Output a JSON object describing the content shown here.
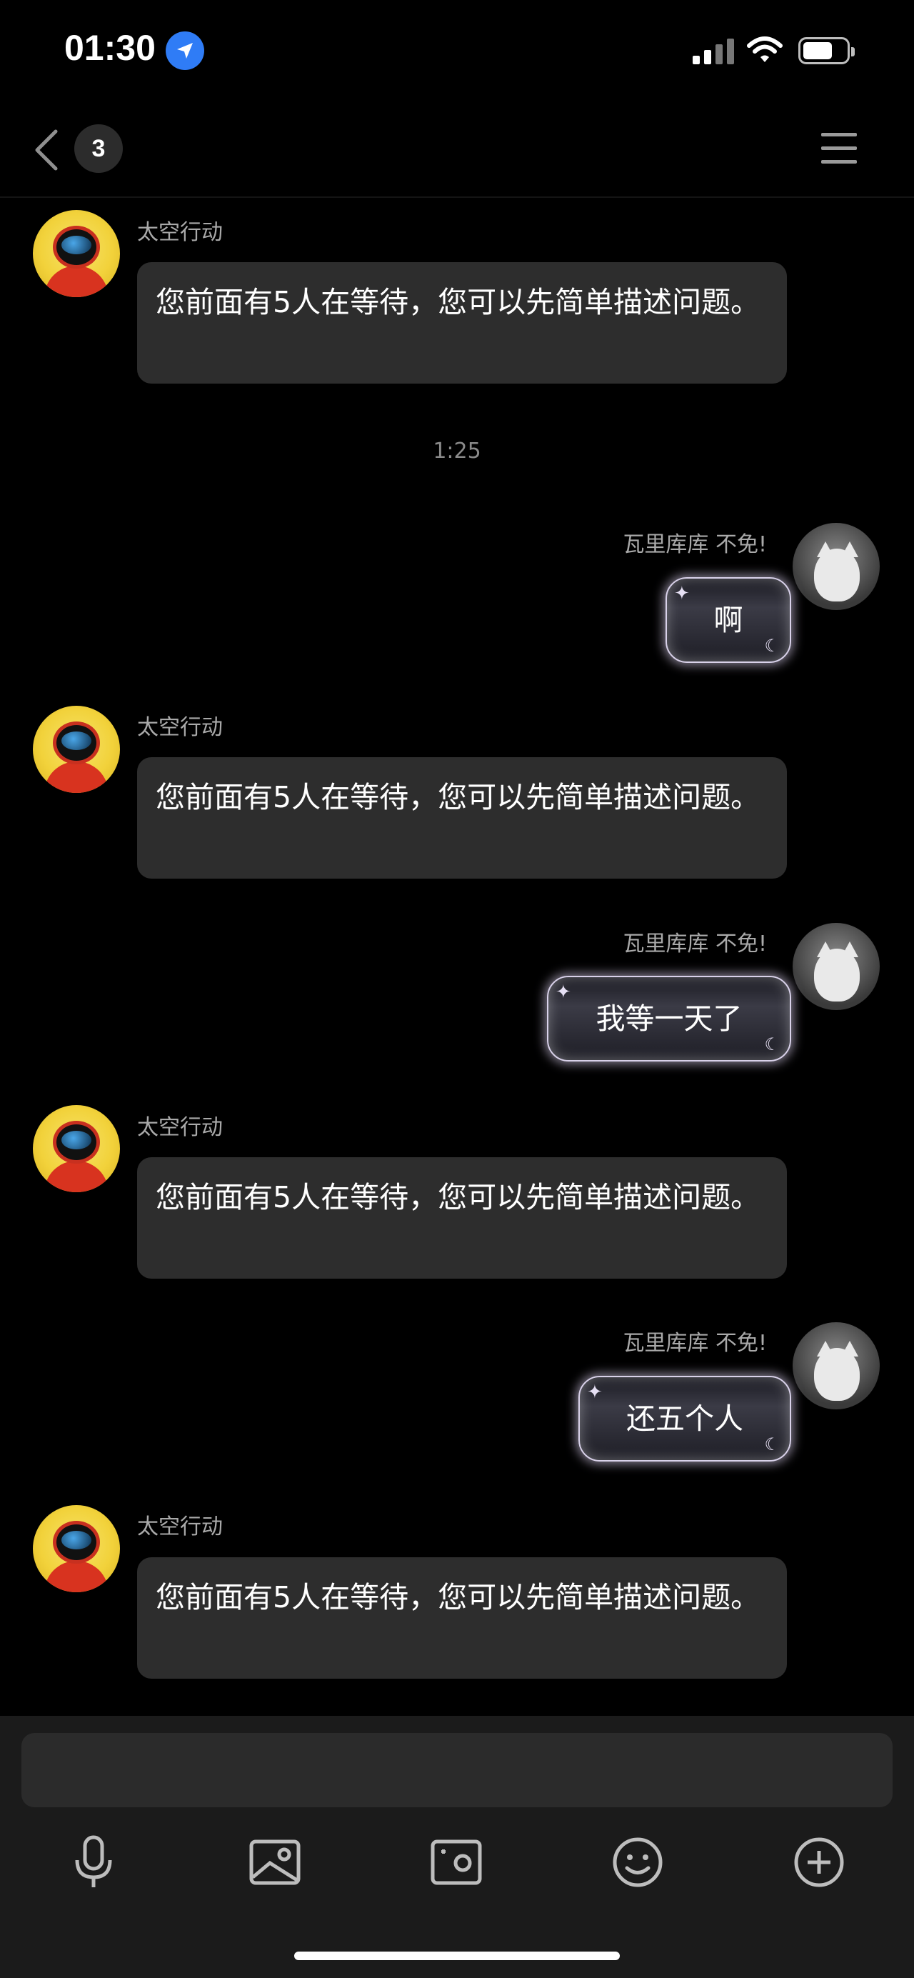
{
  "status_bar": {
    "time": "01:30",
    "icons": [
      "location-arrow-icon",
      "signal-icon",
      "wifi-icon",
      "battery-icon"
    ]
  },
  "nav": {
    "back_icon": "chevron-left-icon",
    "unread_count": "3",
    "menu_icon": "menu-icon"
  },
  "messages": [
    {
      "side": "in",
      "sender": "太空行动",
      "text": "您前面有5人在等待，您可以先简单描述问题。"
    },
    {
      "side": "time",
      "text": "1:25"
    },
    {
      "side": "out",
      "sender": "瓦里库库  不免!",
      "text": "啊"
    },
    {
      "side": "in",
      "sender": "太空行动",
      "text": "您前面有5人在等待，您可以先简单描述问题。"
    },
    {
      "side": "out",
      "sender": "瓦里库库  不免!",
      "text": "我等一天了"
    },
    {
      "side": "in",
      "sender": "太空行动",
      "text": "您前面有5人在等待，您可以先简单描述问题。"
    },
    {
      "side": "out",
      "sender": "瓦里库库  不免!",
      "text": "还五个人"
    },
    {
      "side": "in",
      "sender": "太空行动",
      "text": "您前面有5人在等待，您可以先简单描述问题。"
    }
  ],
  "composer": {
    "input_placeholder": "",
    "tools": [
      "microphone-icon",
      "image-icon",
      "camera-icon",
      "emoji-icon",
      "plus-circle-icon"
    ]
  },
  "colors": {
    "background": "#000000",
    "incoming_bubble": "#2d2d2d",
    "accent": "#2f7cf6"
  }
}
